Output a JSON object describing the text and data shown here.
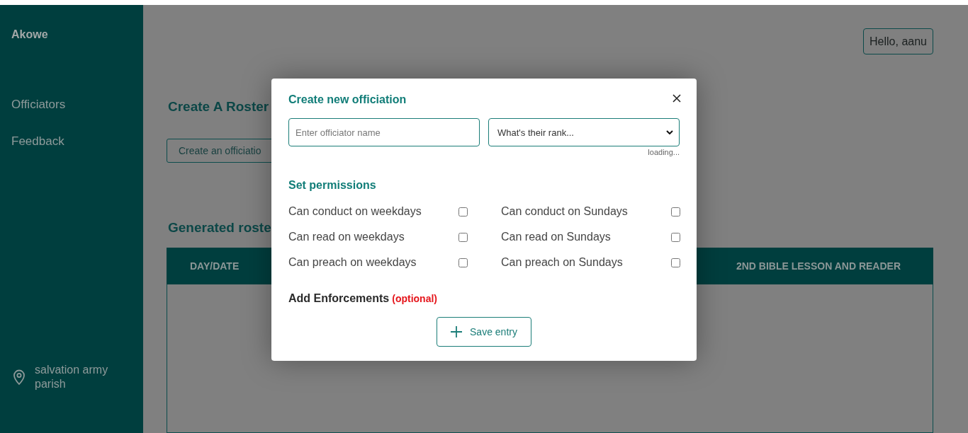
{
  "sidebar": {
    "brand": "Akowe",
    "items": [
      {
        "label": "Officiators"
      },
      {
        "label": "Feedback"
      }
    ],
    "location": "salvation army parish"
  },
  "header": {
    "greeting": "Hello, aanu"
  },
  "main": {
    "title": "Create A Roster",
    "create_button": "Create an officiatio",
    "roster_title": "Generated roste",
    "table": {
      "columns": [
        "DAY/DATE",
        "2ND BIBLE LESSON AND READER"
      ]
    }
  },
  "modal": {
    "title": "Create new officiation",
    "name_field": {
      "placeholder": "Enter officiator name"
    },
    "rank_select": {
      "value": "What's their rank..."
    },
    "status": "loading...",
    "permissions_title": "Set permissions",
    "permissions": [
      {
        "label": "Can conduct on weekdays",
        "checked": false
      },
      {
        "label": "Can conduct on Sundays",
        "checked": false
      },
      {
        "label": "Can read on weekdays",
        "checked": false
      },
      {
        "label": "Can read on Sundays",
        "checked": false
      },
      {
        "label": "Can preach on weekdays",
        "checked": false
      },
      {
        "label": "Can preach on Sundays",
        "checked": false
      }
    ],
    "enforcements": {
      "label": "Add Enforcements",
      "note": "(optional)"
    },
    "save_button": "Save entry"
  }
}
